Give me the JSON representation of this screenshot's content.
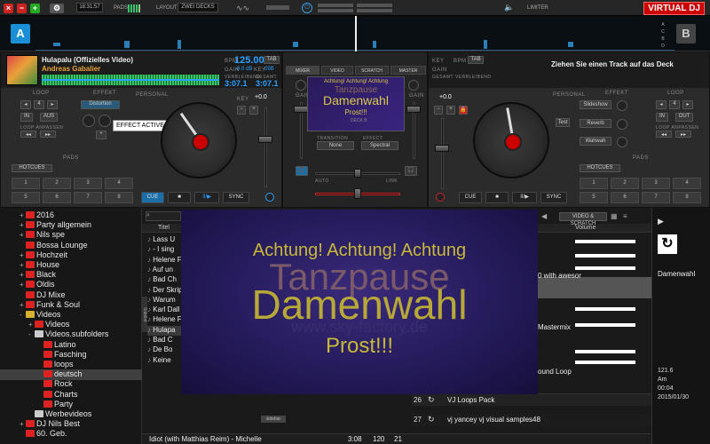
{
  "topbar": {
    "time": "18:31:57",
    "pads_label": "PADS",
    "layout_label": "LAYOUT",
    "layout_value": "ZWEI DECKS",
    "limiter_label": "LIMITER",
    "brand": "VIRTUAL DJ"
  },
  "wavestrip": {
    "deck_a": "A",
    "deck_b": "B",
    "side_letters": [
      "A",
      "C",
      "B",
      "D"
    ]
  },
  "deck_a": {
    "title": "Hulapalu (Offizielles Video)",
    "artist": "Andreas Gabalier",
    "bpm_label": "BPM",
    "bpm": "125.00",
    "tab": "TAB",
    "gain_label": "GAIN",
    "gain_value": "-0.0 dB",
    "key_label": "KEY",
    "key_value": "09B",
    "remaining_label": "VERBLEIBEND",
    "elapsed_label": "GESAMT",
    "remaining": "3:07.1",
    "elapsed": "3:07.1",
    "loop_label": "LOOP",
    "effect_label": "EFFEKT",
    "effect_name": "Distortion",
    "effect_tooltip": "EFFECT ACTIVE",
    "in_label": "IN",
    "out_label": "AUS",
    "loop_adjust_label": "LOOP ANPASSEN",
    "pads_label": "PADS",
    "hotcues_label": "HOTCUES",
    "pads": [
      "1",
      "2",
      "3",
      "4",
      "5",
      "6",
      "7",
      "8"
    ],
    "personal_label": "PERSONAL",
    "cue": "CUE",
    "play": "II/▶",
    "stop": "■",
    "sync": "SYNC",
    "pitch": "+0.0"
  },
  "deck_b": {
    "title": "Ziehen Sie einen Track auf das Deck",
    "bpm_label": "BPM",
    "tab": "TAB",
    "gain_label": "GAIN",
    "key_label": "KEY",
    "remaining_label": "VERBLEIBEND",
    "elapsed_label": "GESAMT",
    "effect_label": "EFFEKT",
    "loop_label": "LOOP",
    "effects": [
      "Slideshow",
      "Reverb",
      "Wahwah"
    ],
    "loop_adjust_label": "LOOP ANPASSEN",
    "pads_label": "PADS",
    "hotcues_label": "HOTCUES",
    "pads": [
      "1",
      "2",
      "3",
      "4",
      "5",
      "6",
      "7",
      "8"
    ],
    "personal_label": "PERSONAL",
    "cue": "CUE",
    "play": "II/▶",
    "stop": "■",
    "sync": "SYNC",
    "pitch": "+0.0",
    "test": "Test"
  },
  "mixer": {
    "tabs": [
      "MIXER",
      "VIDEO",
      "SCRATCH",
      "MASTER"
    ],
    "gain_label": "GAIN",
    "preview_line1": "Achtung! Achtung! Achtung",
    "preview_line2": "Tanzpause",
    "preview_line3": "Damenwahl",
    "preview_line4": "Prost!!!",
    "preview_deck": "DECK B",
    "transition_label": "TRANSITION",
    "transition_value": "None",
    "fx_label": "EFFECT",
    "fx_value": "Spectral",
    "auto_label": "AUTO",
    "link_label": "LINK"
  },
  "browser": {
    "tree": [
      {
        "label": "2016",
        "plus": "+",
        "icon": "red"
      },
      {
        "label": "Party allgemein",
        "plus": "+",
        "icon": "red"
      },
      {
        "label": "Nils spe",
        "plus": "+",
        "icon": "red"
      },
      {
        "label": "Bossa Lounge",
        "plus": "",
        "icon": "red"
      },
      {
        "label": "Hochzeit",
        "plus": "+",
        "icon": "red"
      },
      {
        "label": "House",
        "plus": "+",
        "icon": "red"
      },
      {
        "label": "Black",
        "plus": "+",
        "icon": "red"
      },
      {
        "label": "Oldis",
        "plus": "+",
        "icon": "red"
      },
      {
        "label": "DJ Mixe",
        "plus": "",
        "icon": "red"
      },
      {
        "label": "Funk & Soul",
        "plus": "+",
        "icon": "red"
      },
      {
        "label": "Videos",
        "plus": "-",
        "icon": "yel"
      },
      {
        "label": "Videos",
        "plus": "+",
        "icon": "red"
      },
      {
        "label": "Videos.subfolders",
        "plus": "-",
        "icon": "wht"
      },
      {
        "label": "Latino",
        "plus": "",
        "icon": "red"
      },
      {
        "label": "Fasching",
        "plus": "",
        "icon": "red"
      },
      {
        "label": "loops",
        "plus": "",
        "icon": "red"
      },
      {
        "label": "deutsch",
        "plus": "",
        "icon": "red"
      },
      {
        "label": "Rock",
        "plus": "",
        "icon": "red"
      },
      {
        "label": "Charts",
        "plus": "",
        "icon": "red"
      },
      {
        "label": "Party",
        "plus": "",
        "icon": "red"
      },
      {
        "label": "Werbevideos",
        "plus": "",
        "icon": "wht"
      },
      {
        "label": "DJ Nils Best",
        "plus": "+",
        "icon": "red"
      },
      {
        "label": "60. Geb.",
        "plus": "",
        "icon": "red"
      }
    ],
    "column_title": "Titel",
    "column_volume": "Volume",
    "view_button": "VIDEO & SCRATCH",
    "sidebar_tab": "Sidelist",
    "rows": [
      "Lass U",
      "- I sing",
      "Helene F",
      "Auf un",
      "Bad Ch",
      "Der Skrip",
      "Warum",
      "Karl Dall",
      "Helene F",
      "Hulapa",
      "Bad C",
      "De Bo",
      "Keine"
    ],
    "right_rows": [
      {
        "text": "0 with awesor",
        "num": ""
      },
      {
        "text": "Mastermix",
        "num": ""
      },
      {
        "text": "ound Loop",
        "num": ""
      },
      {
        "text": "VJ Loops Pack",
        "num": "26"
      },
      {
        "text": "vj yancey vj visual samples48",
        "num": "27"
      }
    ],
    "bottom_row": "Idiot (with Matthias Reim) - Michelle",
    "bottom_time": "3:08",
    "bottom_bpm": "120",
    "bottom_count": "21",
    "bottom_tab": "sidebar"
  },
  "right_panel": {
    "title": "Damenwahl",
    "bpm": "121.6",
    "key": "Am",
    "length": "00:04",
    "date": "2015/01/30"
  },
  "overlay": {
    "line1": "Achtung! Achtung! Achtung",
    "line2": "Tanzpause",
    "line3": "Damenwahl",
    "line4": "Prost!!!",
    "watermark": "www.sky-factory.de"
  },
  "colors": {
    "accent_blue": "#1a8fd6",
    "bpm_blue": "#2aa0ff",
    "red": "#cc1111",
    "wave_green": "#3ad86a"
  }
}
